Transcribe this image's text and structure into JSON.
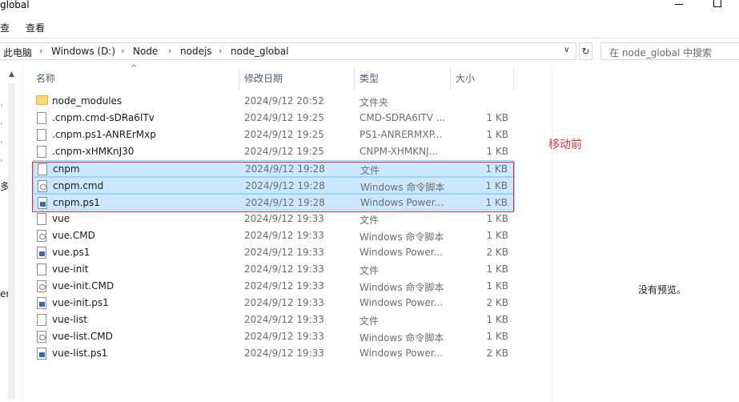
{
  "window": {
    "title": "global",
    "min_icon": "minimize-icon",
    "max_icon": "maximize-icon"
  },
  "ribbon": {
    "tab_cut": "查",
    "tab_view": "查看"
  },
  "address": {
    "crumbs": [
      "此电脑",
      "Windows (D:)",
      "Node",
      "nodejs",
      "node_global"
    ],
    "separator": "›",
    "dropdown_glyph": "∨",
    "refresh_glyph": "↻"
  },
  "search": {
    "placeholder": "在 node_global 中搜索"
  },
  "nav": {
    "fragments": [
      "多",
      "er"
    ]
  },
  "columns": {
    "name": "名称",
    "date": "修改日期",
    "type": "类型",
    "size": "大小",
    "sort_glyph": "^"
  },
  "files": [
    {
      "name": "node_modules",
      "date": "2024/9/12 20:52",
      "type": "文件夹",
      "size": "",
      "icon": "folder-icon"
    },
    {
      "name": ".cnpm.cmd-sDRa6ITv",
      "date": "2024/9/12 19:25",
      "type": "CMD-SDRA6ITV ...",
      "size": "1 KB",
      "icon": "file-icon"
    },
    {
      "name": ".cnpm.ps1-ANRErMxp",
      "date": "2024/9/12 19:25",
      "type": "PS1-ANRERMXP...",
      "size": "1 KB",
      "icon": "file-icon"
    },
    {
      "name": ".cnpm-xHMKnJ30",
      "date": "2024/9/12 19:25",
      "type": "CNPM-XHMKNJ...",
      "size": "1 KB",
      "icon": "file-icon"
    },
    {
      "name": "cnpm",
      "date": "2024/9/12 19:28",
      "type": "文件",
      "size": "1 KB",
      "icon": "file-icon",
      "selected": true
    },
    {
      "name": "cnpm.cmd",
      "date": "2024/9/12 19:28",
      "type": "Windows 命令脚本",
      "size": "1 KB",
      "icon": "cmd-file-icon",
      "selected": true
    },
    {
      "name": "cnpm.ps1",
      "date": "2024/9/12 19:28",
      "type": "Windows Power...",
      "size": "1 KB",
      "icon": "powershell-file-icon",
      "selected": true
    },
    {
      "name": "vue",
      "date": "2024/9/12 19:33",
      "type": "文件",
      "size": "1 KB",
      "icon": "file-icon"
    },
    {
      "name": "vue.CMD",
      "date": "2024/9/12 19:33",
      "type": "Windows 命令脚本",
      "size": "1 KB",
      "icon": "cmd-file-icon"
    },
    {
      "name": "vue.ps1",
      "date": "2024/9/12 19:33",
      "type": "Windows Power...",
      "size": "2 KB",
      "icon": "powershell-file-icon"
    },
    {
      "name": "vue-init",
      "date": "2024/9/12 19:33",
      "type": "文件",
      "size": "1 KB",
      "icon": "file-icon"
    },
    {
      "name": "vue-init.CMD",
      "date": "2024/9/12 19:33",
      "type": "Windows 命令脚本",
      "size": "1 KB",
      "icon": "cmd-file-icon"
    },
    {
      "name": "vue-init.ps1",
      "date": "2024/9/12 19:33",
      "type": "Windows Power...",
      "size": "2 KB",
      "icon": "powershell-file-icon"
    },
    {
      "name": "vue-list",
      "date": "2024/9/12 19:33",
      "type": "文件",
      "size": "1 KB",
      "icon": "file-icon"
    },
    {
      "name": "vue-list.CMD",
      "date": "2024/9/12 19:33",
      "type": "Windows 命令脚本",
      "size": "1 KB",
      "icon": "cmd-file-icon"
    },
    {
      "name": "vue-list.ps1",
      "date": "2024/9/12 19:33",
      "type": "Windows Power...",
      "size": "2 KB",
      "icon": "powershell-file-icon"
    }
  ],
  "annotation": {
    "text": "移动前",
    "color": "#e0322f"
  },
  "preview": {
    "empty_text": "没有预览。"
  },
  "colors": {
    "selection_bg": "#cce8ff",
    "selection_border": "#99d1ff",
    "header_text": "#4c607a"
  }
}
